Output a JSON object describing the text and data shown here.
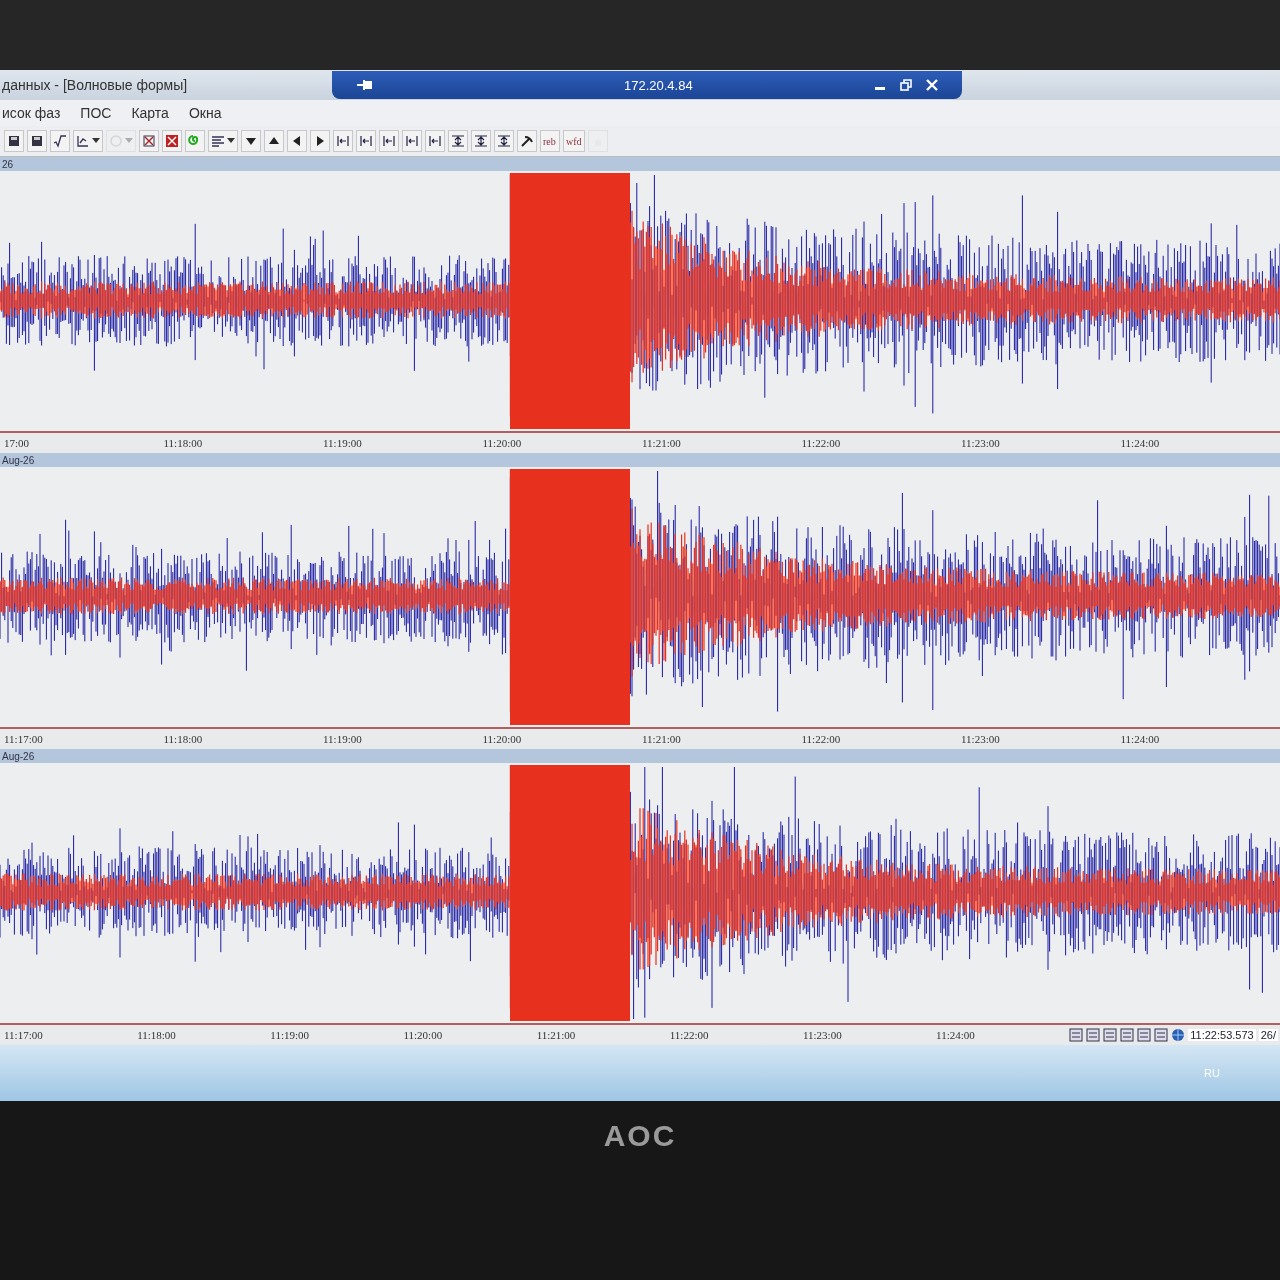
{
  "window": {
    "title": "данных - [Волновые формы]",
    "remote_title": "172.20.4.84"
  },
  "menu": [
    {
      "label": "исок фаз"
    },
    {
      "label": "ПОС"
    },
    {
      "label": "Карта"
    },
    {
      "label": "Окна"
    }
  ],
  "toolbar": [
    {
      "kind": "button",
      "disabled": false
    },
    {
      "kind": "button",
      "disabled": false
    },
    {
      "kind": "button",
      "disabled": false
    },
    {
      "kind": "dropdown",
      "disabled": false
    },
    {
      "kind": "dropdown",
      "disabled": true
    },
    {
      "kind": "button",
      "disabled": false
    },
    {
      "kind": "button",
      "disabled": false
    },
    {
      "kind": "button",
      "disabled": false
    },
    {
      "kind": "dropdown",
      "disabled": false
    },
    {
      "kind": "button",
      "disabled": false
    },
    {
      "kind": "button",
      "disabled": false
    },
    {
      "kind": "button",
      "disabled": false
    },
    {
      "kind": "button",
      "disabled": false
    },
    {
      "kind": "button",
      "disabled": false
    },
    {
      "kind": "button",
      "disabled": false
    },
    {
      "kind": "button",
      "disabled": false
    },
    {
      "kind": "button",
      "disabled": false
    },
    {
      "kind": "button",
      "disabled": false
    },
    {
      "kind": "button",
      "disabled": false
    },
    {
      "kind": "button",
      "disabled": false
    },
    {
      "kind": "button",
      "disabled": false
    },
    {
      "kind": "button",
      "disabled": false
    },
    {
      "kind": "text",
      "label": "reb",
      "disabled": false
    },
    {
      "kind": "text",
      "label": "wfd",
      "disabled": false
    },
    {
      "kind": "button",
      "disabled": true
    }
  ],
  "panels": [
    {
      "label": "26",
      "axis": [
        "17:00",
        "11:18:00",
        "11:19:00",
        "11:20:00",
        "11:21:00",
        "11:22:00",
        "11:23:00",
        "11:24:00"
      ]
    },
    {
      "label": "Aug-26",
      "axis": [
        "11:17:00",
        "11:18:00",
        "11:19:00",
        "11:20:00",
        "11:21:00",
        "11:22:00",
        "11:23:00",
        "11:24:00"
      ]
    },
    {
      "label": "Aug-26",
      "axis": [
        "11:17:00",
        "11:18:00",
        "11:19:00",
        "11:20:00",
        "11:21:00",
        "11:22:00",
        "11:23:00",
        "11:24:00"
      ]
    }
  ],
  "status_bar": {
    "clock": "11:22:53.573",
    "date": "26/"
  },
  "taskbar": {
    "language": "RU"
  },
  "monitor": {
    "brand": "AOC"
  }
}
